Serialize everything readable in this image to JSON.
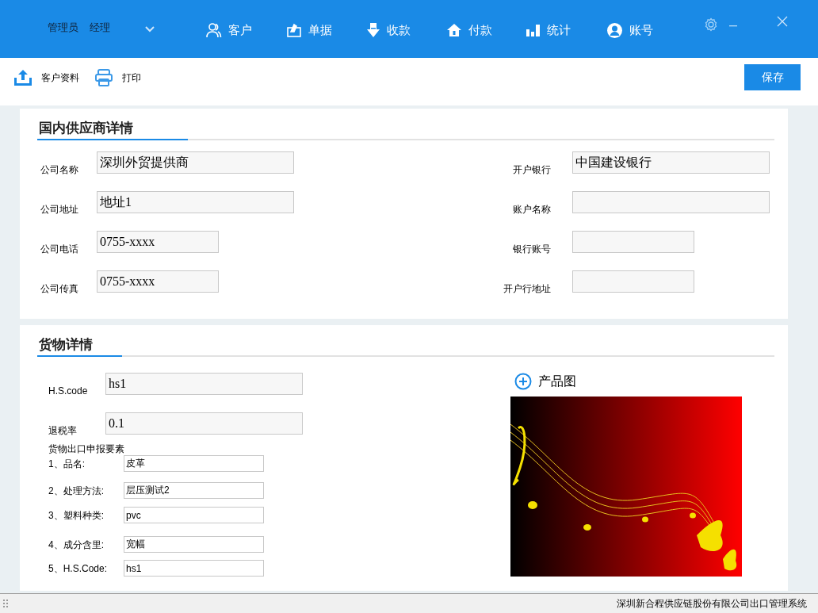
{
  "header": {
    "user": "管理员",
    "role": "经理",
    "nav": [
      {
        "label": "客户"
      },
      {
        "label": "单据"
      },
      {
        "label": "收款"
      },
      {
        "label": "付款"
      },
      {
        "label": "统计"
      },
      {
        "label": "账号"
      }
    ]
  },
  "toolbar": {
    "actions": [
      {
        "label": "客户资料"
      },
      {
        "label": "打印"
      }
    ],
    "save": "保存"
  },
  "supplier": {
    "title": "国内供应商详情",
    "left": [
      {
        "label": "公司名称",
        "value": "深圳外贸提供商",
        "kind": "wide"
      },
      {
        "label": "公司地址",
        "value": "地址1",
        "kind": "wide"
      },
      {
        "label": "公司电话",
        "value": "0755-xxxx",
        "kind": "narrow"
      },
      {
        "label": "公司传真",
        "value": "0755-xxxx",
        "kind": "narrow"
      }
    ],
    "right": [
      {
        "label": "开户银行",
        "value": "中国建设银行",
        "kind": "wide"
      },
      {
        "label": "账户名称",
        "kind": "wide"
      },
      {
        "label": "银行账号",
        "kind": "narrow"
      },
      {
        "label": "开户行地址",
        "kind": "narrow"
      }
    ]
  },
  "goods": {
    "title": "货物详情",
    "fields": [
      {
        "label": "H.S.code",
        "value": "hs1"
      },
      {
        "label": "退税率",
        "value": "0.1"
      }
    ],
    "declaration_title": "货物出口申报要素",
    "declaration": [
      {
        "label": "1、品名:",
        "value": "皮革"
      },
      {
        "label": "2、处理方法:",
        "value": "层压测试2"
      },
      {
        "label": "3、塑料种类:",
        "value": "pvc"
      },
      {
        "label": "4、成分含里:",
        "value": "宽幅"
      },
      {
        "label": "5、H.S.Code:",
        "value": "hs1"
      }
    ],
    "product_image": {
      "label": "产品图",
      "kind": "picture"
    }
  },
  "status_bar": "深圳新合程供应链股份有限公司出口管理系统"
}
